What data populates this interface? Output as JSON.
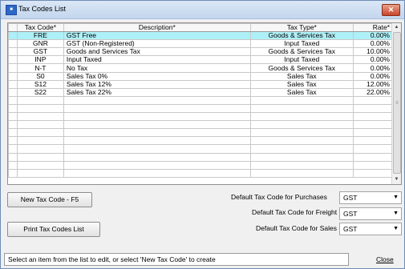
{
  "window": {
    "title": "Tax Codes List",
    "icon": "app-icon"
  },
  "grid": {
    "columns": [
      "Tax Code*",
      "Description*",
      "Tax Type*",
      "Rate*"
    ],
    "rows": [
      {
        "code": "FRE",
        "desc": "GST Free",
        "type": "Goods & Services Tax",
        "rate": "0.00%",
        "selected": true
      },
      {
        "code": "GNR",
        "desc": "GST (Non-Registered)",
        "type": "Input Taxed",
        "rate": "0.00%"
      },
      {
        "code": "GST",
        "desc": "Goods and Services Tax",
        "type": "Goods & Services Tax",
        "rate": "10.00%"
      },
      {
        "code": "INP",
        "desc": "Input Taxed",
        "type": "Input Taxed",
        "rate": "0.00%"
      },
      {
        "code": "N-T",
        "desc": "No Tax",
        "type": "Goods & Services Tax",
        "rate": "0.00%"
      },
      {
        "code": "S0",
        "desc": "Sales Tax 0%",
        "type": "Sales Tax",
        "rate": "0.00%"
      },
      {
        "code": "S12",
        "desc": "Sales Tax 12%",
        "type": "Sales Tax",
        "rate": "12.00%"
      },
      {
        "code": "S22",
        "desc": "Sales Tax 22%",
        "type": "Sales Tax",
        "rate": "22.00%"
      }
    ],
    "empty_rows": 10
  },
  "buttons": {
    "new_tax_code": "New Tax Code - F5",
    "print_list": "Print Tax Codes List"
  },
  "defaults": {
    "purchases_label": "Default Tax Code for Purchases",
    "purchases_value": "GST",
    "freight_label": "Default Tax Code for Freight",
    "freight_value": "GST",
    "sales_label": "Default Tax Code for Sales",
    "sales_value": "GST"
  },
  "status": {
    "message": "Select an item from the list to edit, or select 'New Tax Code' to create",
    "close_label": "Close"
  }
}
